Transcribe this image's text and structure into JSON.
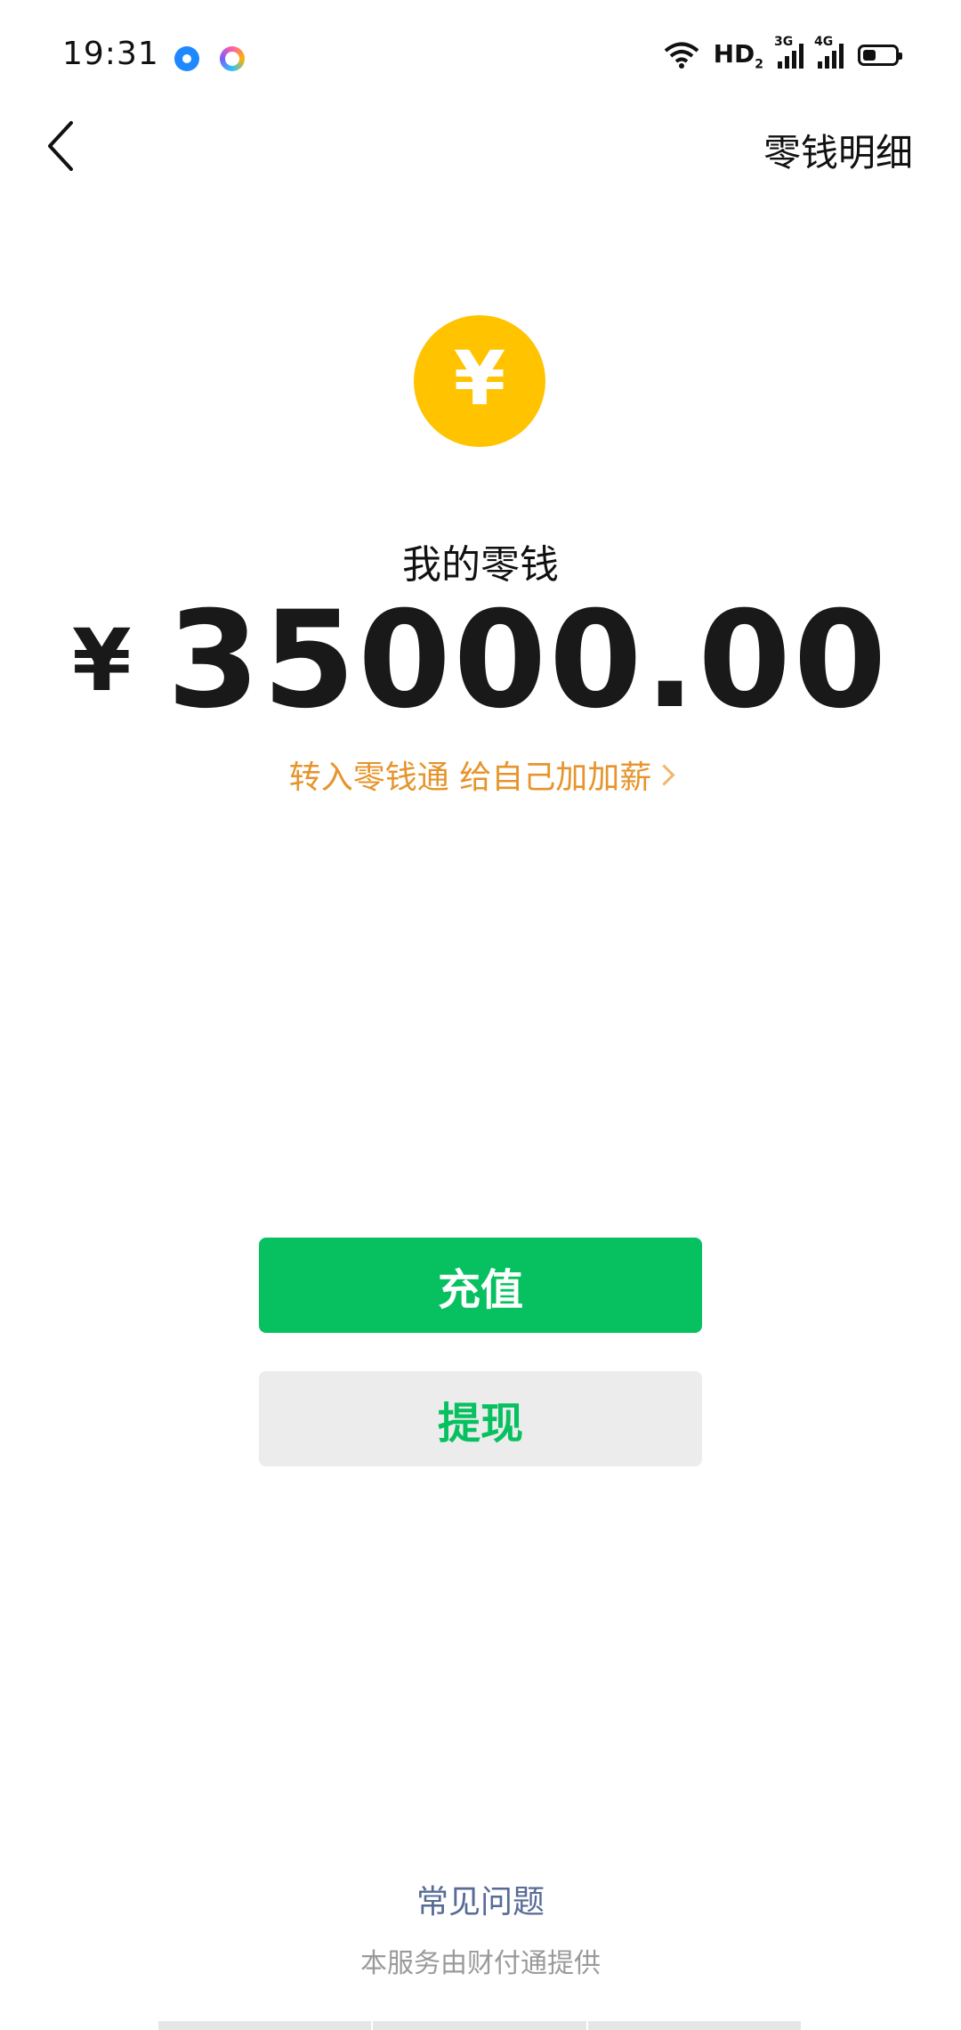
{
  "status_bar": {
    "time": "19:31",
    "hd_label": "HD",
    "hd_sub": "2",
    "sim1_label": "3G",
    "sim2_label": "4G",
    "icons": [
      "notification-app-icon",
      "messaging-app-icon",
      "wifi-icon",
      "signal-icon",
      "battery-icon"
    ]
  },
  "nav": {
    "back_icon": "chevron-left-icon",
    "detail_link": "零钱明细"
  },
  "balance": {
    "title": "我的零钱",
    "currency": "¥",
    "amount": "35000.00",
    "promo": "转入零钱通 给自己加加薪"
  },
  "actions": {
    "recharge_label": "充值",
    "withdraw_label": "提现"
  },
  "footer": {
    "faq": "常见问题",
    "provider": "本服务由财付通提供"
  },
  "colors": {
    "primary_green": "#07C160",
    "coin_yellow": "#FFC300",
    "promo_orange": "#E6942B",
    "link_blue": "#576B95"
  }
}
